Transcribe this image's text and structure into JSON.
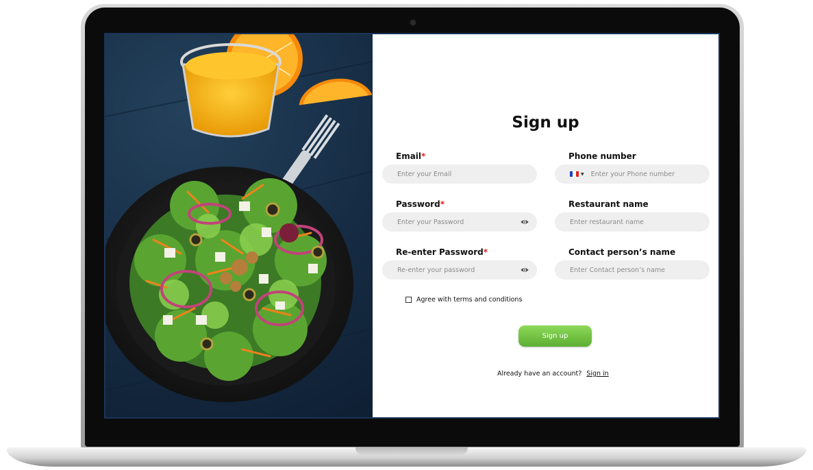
{
  "page": {
    "title": "Sign up"
  },
  "form": {
    "email": {
      "label": "Email",
      "required_mark": "*",
      "placeholder": "Enter your Email"
    },
    "phone": {
      "label": "Phone number",
      "placeholder": "Enter your Phone number",
      "flag_icon": "france-flag-icon",
      "flag_colors": [
        "#1f3fbf",
        "#ffffff",
        "#e1261c"
      ]
    },
    "password": {
      "label": "Password",
      "required_mark": "*",
      "placeholder": "Enter your Password",
      "toggle_icon": "eye-icon"
    },
    "restaurant": {
      "label": "Restaurant name",
      "placeholder": "Enter restaurant name"
    },
    "reenter_password": {
      "label": "Re-enter Password",
      "required_mark": "*",
      "placeholder": "Re-enter your password",
      "toggle_icon": "eye-icon"
    },
    "contact": {
      "label": "Contact person’s name",
      "placeholder": "Enter Contact person’s name"
    },
    "terms_label": "Agree with terms and conditions",
    "signup_button": "Sign up",
    "account_prompt": "Already have an account?",
    "signin_link": "Sign in"
  },
  "colors": {
    "accent_green": "#6cc13f",
    "required_red": "#e02020",
    "field_bg": "#efefef"
  }
}
